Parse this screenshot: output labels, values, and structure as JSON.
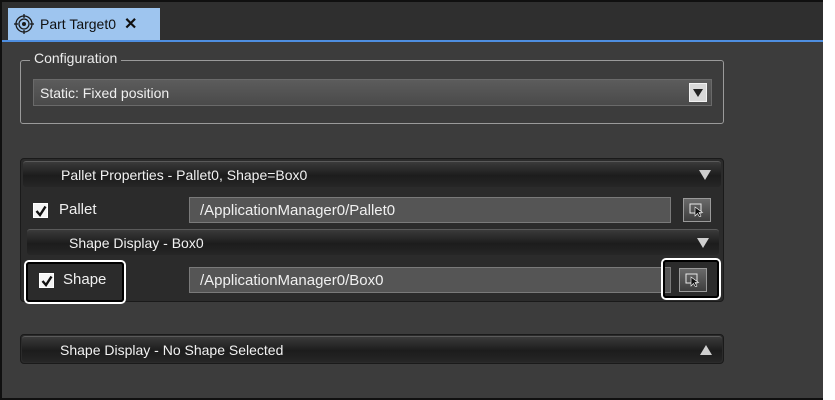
{
  "tab": {
    "title": "Part Target0",
    "close": "✕",
    "icon": "target-icon"
  },
  "tabbar": {
    "overflow_glyph": "▾"
  },
  "configuration": {
    "legend": "Configuration",
    "selected": "Static: Fixed position"
  },
  "pallet_properties": {
    "header": "Pallet Properties - Pallet0, Shape=Box0",
    "pallet": {
      "checked": true,
      "label": "Pallet",
      "value": "/ApplicationManager0/Pallet0"
    },
    "shape_display": {
      "header": "Shape Display - Box0",
      "shape": {
        "checked": true,
        "label": "Shape",
        "value": "/ApplicationManager0/Box0"
      }
    }
  },
  "shape_display_none": {
    "header": "Shape Display - No Shape Selected"
  },
  "colors": {
    "accent": "#4e8ee0",
    "tab_bg": "#9ec5ef",
    "panel_bg": "#3c3c3c",
    "highlight": "#ffffff"
  }
}
